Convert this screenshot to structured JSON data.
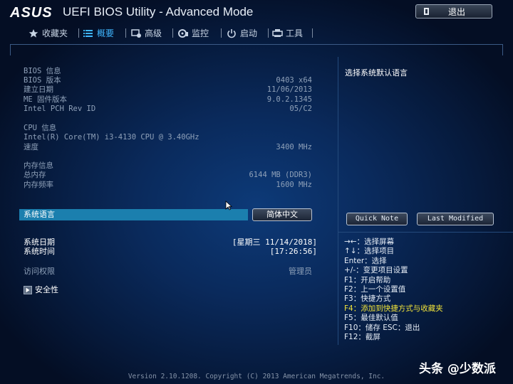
{
  "titlebar": {
    "logo": "ASUS",
    "title": "UEFI BIOS Utility - Advanced Mode",
    "exit_label": "退出"
  },
  "menu": {
    "items": [
      {
        "label": "收藏夹",
        "icon": "star-icon"
      },
      {
        "label": "概要",
        "icon": "list-icon",
        "active": true
      },
      {
        "label": "高级",
        "icon": "advanced-icon"
      },
      {
        "label": "监控",
        "icon": "monitor-icon"
      },
      {
        "label": "启动",
        "icon": "power-icon"
      },
      {
        "label": "工具",
        "icon": "tool-icon"
      }
    ]
  },
  "bios": {
    "heading": "BIOS 信息",
    "version_label": "BIOS 版本",
    "version_value": "0403 x64",
    "build_label": "建立日期",
    "build_value": "11/06/2013",
    "me_label": "ME 固件版本",
    "me_value": "9.0.2.1345",
    "pch_label": "Intel PCH Rev ID",
    "pch_value": "05/C2"
  },
  "cpu": {
    "heading": "CPU 信息",
    "model": "Intel(R) Core(TM) i3-4130 CPU @ 3.40GHz",
    "speed_label": "速度",
    "speed_value": "3400 MHz"
  },
  "memory": {
    "heading": "内存信息",
    "total_label": "总内存",
    "total_value": "6144 MB (DDR3)",
    "freq_label": "内存频率",
    "freq_value": "1600 MHz"
  },
  "language": {
    "label": "系统语言",
    "value": "简体中文"
  },
  "system": {
    "date_label": "系统日期",
    "date_value": "[星期三 11/14/2018]",
    "time_label": "系统时间",
    "time_value": "[17:26:56]",
    "access_label": "访问权限",
    "access_value": "管理员",
    "security_label": "安全性"
  },
  "help": {
    "title": "选择系统默认语言",
    "quick_note": "Quick Note",
    "last_modified": "Last Modified",
    "keys": [
      "→←：选择屏幕",
      "↑↓：选择项目",
      "Enter：选择",
      "+/-：变更项目设置",
      "F1：开启帮助",
      "F2：上一个设置值",
      "F3：快捷方式",
      "F4：添加到快捷方式与收藏夹",
      "F5：最佳默认值",
      "F10：储存  ESC：退出",
      "F12：截屏"
    ]
  },
  "footer": "Version 2.10.1208. Copyright (C) 2013 American Megatrends, Inc.",
  "watermark": "头条 @少数派",
  "colors": {
    "accent_blue": "#3fb6ff",
    "highlight_bar": "#1b7fae",
    "hotkey_highlight": "#f0e23a"
  }
}
